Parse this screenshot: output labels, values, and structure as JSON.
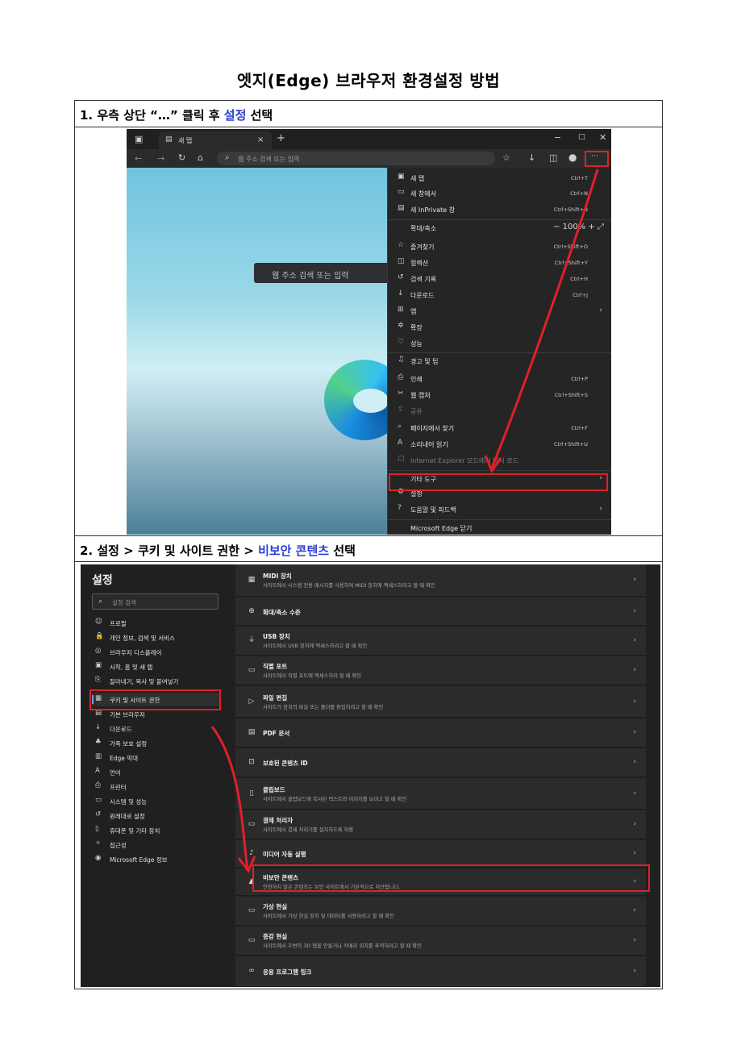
{
  "title": "엣지(Edge) 브라우저 환경설정 방법",
  "step1": {
    "prefix": "1. 우측 상단 “…” 클릭 후 ",
    "highlight": "설정",
    "suffix": " 선택"
  },
  "step2": {
    "prefix": "2. 설정 > 쿠키 및 사이트 권한 > ",
    "highlight": "비보안 콘텐츠",
    "suffix": " 선택"
  },
  "accent_color": "#2b3fd6",
  "callout_color": "#e0202a",
  "browser": {
    "tab_title": "새 탭",
    "address_placeholder": "웹 주소 검색 또는 입력",
    "page_search_placeholder": "웹 주소 검색 또는 입력",
    "more_button": "···",
    "menu": [
      {
        "icon": "new-tab-icon",
        "glyph": "▣",
        "label": "새 탭",
        "shortcut": "Ctrl+T"
      },
      {
        "icon": "new-window-icon",
        "glyph": "▭",
        "label": "새 창에서",
        "shortcut": "Ctrl+N"
      },
      {
        "icon": "inprivate-icon",
        "glyph": "▤",
        "label": "새 InPrivate 창",
        "shortcut": "Ctrl+Shift+N"
      },
      {
        "icon": "zoom-icon",
        "glyph": "",
        "label": "확대/축소",
        "zoom": "−   100%   +   ⤢"
      },
      {
        "icon": "favorites-icon",
        "glyph": "☆",
        "label": "즐겨찾기",
        "shortcut": "Ctrl+Shift+O"
      },
      {
        "icon": "collections-icon",
        "glyph": "◫",
        "label": "컬렉션",
        "shortcut": "Ctrl+Shift+Y"
      },
      {
        "icon": "history-icon",
        "glyph": "↺",
        "label": "검색 기록",
        "shortcut": "Ctrl+H"
      },
      {
        "icon": "download-icon",
        "glyph": "↓",
        "label": "다운로드",
        "shortcut": "Ctrl+J"
      },
      {
        "icon": "apps-icon",
        "glyph": "⊞",
        "label": "앱",
        "arrow": "›"
      },
      {
        "icon": "extensions-icon",
        "glyph": "✲",
        "label": "확장"
      },
      {
        "icon": "performance-icon",
        "glyph": "♡",
        "label": "성능"
      },
      {
        "icon": "alerts-icon",
        "glyph": "♫",
        "label": "경고 및 팁"
      },
      {
        "icon": "print-icon",
        "glyph": "⎙",
        "label": "인쇄",
        "shortcut": "Ctrl+P"
      },
      {
        "icon": "web-capture-icon",
        "glyph": "✂",
        "label": "웹 캡처",
        "shortcut": "Ctrl+Shift+S"
      },
      {
        "icon": "share-icon",
        "glyph": "⇪",
        "label": "공유",
        "dim": true
      },
      {
        "icon": "find-icon",
        "glyph": "⌕",
        "label": "페이지에서 찾기",
        "shortcut": "Ctrl+F"
      },
      {
        "icon": "read-aloud-icon",
        "glyph": "A",
        "label": "소리내어 읽기",
        "shortcut": "Ctrl+Shift+U"
      },
      {
        "icon": "ie-mode-icon",
        "glyph": "▢",
        "label": "Internet Explorer 모드에서 다시 로드",
        "dim": true
      },
      {
        "icon": "more-tools-icon",
        "glyph": "",
        "label": "기타 도구",
        "arrow": "›"
      },
      {
        "icon": "settings-icon",
        "glyph": "⚙",
        "label": "설정"
      },
      {
        "icon": "help-icon",
        "glyph": "?",
        "label": "도움말 및 피드백",
        "arrow": "›"
      },
      {
        "icon": "close-edge-icon",
        "glyph": "",
        "label": "Microsoft Edge 닫기"
      }
    ]
  },
  "settings": {
    "title": "설정",
    "search_placeholder": "설정 검색",
    "sidebar": [
      {
        "icon": "profile-icon",
        "glyph": "☺",
        "label": "프로필"
      },
      {
        "icon": "privacy-icon",
        "glyph": "🔒",
        "label": "개인 정보, 검색 및 서비스"
      },
      {
        "icon": "appearance-icon",
        "glyph": "◎",
        "label": "브라우저 디스플레이"
      },
      {
        "icon": "start-page-icon",
        "glyph": "▣",
        "label": "시작, 홈 및 새 탭"
      },
      {
        "icon": "share-copy-icon",
        "glyph": "⎘",
        "label": "잘라내기, 복사 및 붙여넣기"
      },
      {
        "icon": "cookies-icon",
        "glyph": "▦",
        "label": "쿠키 및 사이트 권한",
        "active": true
      },
      {
        "icon": "default-browser-icon",
        "glyph": "▤",
        "label": "기본 브라우저"
      },
      {
        "icon": "downloads-icon",
        "glyph": "↓",
        "label": "다운로드"
      },
      {
        "icon": "family-icon",
        "glyph": "♣",
        "label": "가족 보호 설정"
      },
      {
        "icon": "edge-bar-icon",
        "glyph": "▥",
        "label": "Edge 막대"
      },
      {
        "icon": "languages-icon",
        "glyph": "A",
        "label": "언어"
      },
      {
        "icon": "printers-icon",
        "glyph": "⎙",
        "label": "프린터"
      },
      {
        "icon": "system-icon",
        "glyph": "▭",
        "label": "시스템 및 성능"
      },
      {
        "icon": "reset-icon",
        "glyph": "↺",
        "label": "원래대로 설정"
      },
      {
        "icon": "phone-icon",
        "glyph": "▯",
        "label": "휴대폰 및 기타 장치"
      },
      {
        "icon": "accessibility-icon",
        "glyph": "✧",
        "label": "접근성"
      },
      {
        "icon": "about-edge-icon",
        "glyph": "◉",
        "label": "Microsoft Edge 정보"
      }
    ],
    "rows": [
      {
        "icon": "midi-icon",
        "glyph": "▦",
        "title": "MIDI 장치",
        "desc": "사이트에서 시스템 전용 메시지를 사용하여 MIDI 장치에 액세스하려고 할 때 확인"
      },
      {
        "icon": "zoom-level-icon",
        "glyph": "⊕",
        "title": "확대/축소 수준",
        "desc": ""
      },
      {
        "icon": "usb-icon",
        "glyph": "⏚",
        "title": "USB 장치",
        "desc": "사이트에서 USB 장치에 액세스하려고 할 때 확인"
      },
      {
        "icon": "serial-port-icon",
        "glyph": "▭",
        "title": "직렬 포트",
        "desc": "사이트에서 직렬 포트에 액세스하려 할 때 확인"
      },
      {
        "icon": "file-edit-icon",
        "glyph": "▷",
        "title": "파일 편집",
        "desc": "사이트가 장치의 파일 또는 폴더를 편집하려고 할 때 확인"
      },
      {
        "icon": "pdf-icon",
        "glyph": "▤",
        "title": "PDF 문서",
        "desc": ""
      },
      {
        "icon": "protected-content-icon",
        "glyph": "⊡",
        "title": "보호된 콘텐츠 ID",
        "desc": ""
      },
      {
        "icon": "clipboard-icon",
        "glyph": "▯",
        "title": "클립보드",
        "desc": "사이트에서 클립보드에 복사된 텍스트와 이미지를 보려고 할 때 확인"
      },
      {
        "icon": "payment-icon",
        "glyph": "▭",
        "title": "결제 처리자",
        "desc": "사이트에서 결제 처리기를 설치하도록 허용"
      },
      {
        "icon": "media-autoplay-icon",
        "glyph": "♪",
        "title": "미디어 자동 실행",
        "desc": ""
      },
      {
        "icon": "insecure-content-icon",
        "glyph": "▲",
        "title": "비보안 콘텐츠",
        "desc": "안전하지 않은 콘텐츠는 보안 사이트에서 기본적으로 차단됩니다."
      },
      {
        "icon": "vr-icon",
        "glyph": "▭",
        "title": "가상 현실",
        "desc": "사이트에서 가상 현실 장치 및 데이터를 사용하려고 할 때 확인"
      },
      {
        "icon": "ar-icon",
        "glyph": "▭",
        "title": "증강 현실",
        "desc": "사이트에서 주변의 3D 맵을 만들거나 카메라 위치를 추적하려고 할 때 확인"
      },
      {
        "icon": "app-links-icon",
        "glyph": "∞",
        "title": "응용 프로그램 링크",
        "desc": ""
      }
    ]
  }
}
